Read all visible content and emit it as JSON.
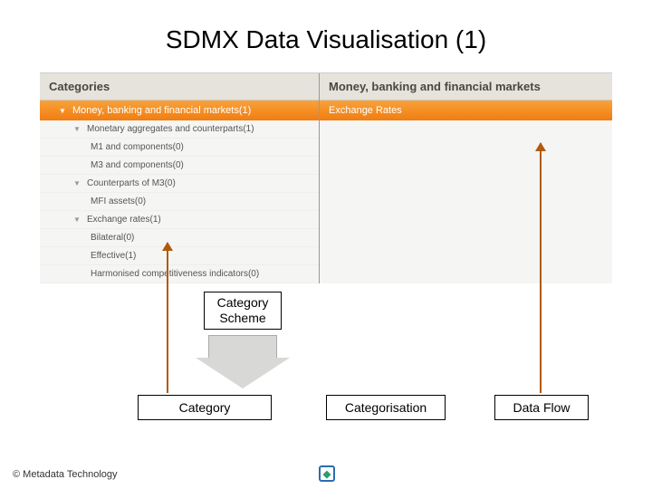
{
  "title": "SDMX Data Visualisation (1)",
  "left_header": "Categories",
  "right_header": "Money, banking and financial markets",
  "tree": {
    "root": "Money, banking and financial markets(1)",
    "n1": "Monetary aggregates and counterparts(1)",
    "n1a": "M1 and components(0)",
    "n1b": "M3 and components(0)",
    "n1c": "Counterparts of M3(0)",
    "n2": "MFI assets(0)",
    "n3": "Exchange rates(1)",
    "n3a": "Bilateral(0)",
    "n3b": "Effective(1)",
    "n3c": "Harmonised competitiveness indicators(0)"
  },
  "right_row": "Exchange Rates",
  "labels": {
    "cat_scheme": "Category Scheme",
    "category": "Category",
    "categorisation": "Categorisation",
    "dataflow": "Data Flow"
  },
  "footer": "© Metadata Technology"
}
